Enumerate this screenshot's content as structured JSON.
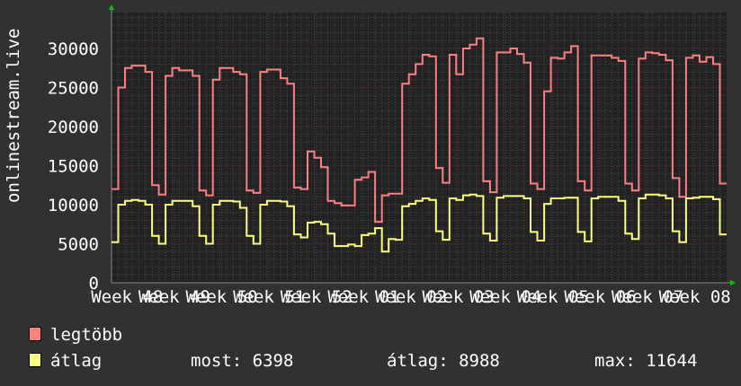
{
  "chart_data": {
    "type": "line",
    "ylabel": "onlinestream.live",
    "ylim": [
      0,
      30000
    ],
    "yticks": [
      "0",
      "5000",
      "10000",
      "15000",
      "20000",
      "25000",
      "30000"
    ],
    "xtick_labels": [
      "Week 48",
      "Week 49",
      "Week 50",
      "Week 51",
      "Week 52",
      "Week 01",
      "Week 02",
      "Week 03",
      "Week 04",
      "Week 05",
      "Week 06",
      "Week 07",
      "Week 08"
    ],
    "grid": true,
    "step": true,
    "series": [
      {
        "name": "legtöbb",
        "color": "#ff8080",
        "values": [
          12000,
          25000,
          27500,
          27800,
          27800,
          27000,
          12500,
          11300,
          26500,
          27500,
          27200,
          27200,
          26500,
          11800,
          11200,
          26000,
          27500,
          27500,
          27000,
          26700,
          11800,
          11500,
          27000,
          27300,
          27300,
          26200,
          25500,
          12200,
          12000,
          16800,
          16000,
          14800,
          10500,
          10200,
          9900,
          9900,
          13200,
          13500,
          14200,
          7800,
          11200,
          11400,
          11400,
          25500,
          26700,
          28000,
          29200,
          29000,
          14700,
          12800,
          29200,
          26700,
          30000,
          30500,
          31300,
          13000,
          11600,
          29500,
          29500,
          30000,
          29300,
          28200,
          12700,
          12000,
          24500,
          28800,
          28700,
          29500,
          30300,
          13000,
          11800,
          29100,
          29100,
          29100,
          28800,
          28400,
          12700,
          11800,
          28700,
          29500,
          29400,
          29200,
          28500,
          13400,
          11000,
          28800,
          29100,
          28300,
          28900,
          28000,
          12700
        ]
      },
      {
        "name": "átlag",
        "color": "#ffff80",
        "values": [
          5200,
          10000,
          10500,
          10600,
          10500,
          10000,
          6000,
          5000,
          10000,
          10500,
          10500,
          10500,
          9800,
          6000,
          5000,
          10000,
          10500,
          10500,
          10400,
          9600,
          6000,
          5000,
          10000,
          10500,
          10500,
          10400,
          9800,
          6200,
          5800,
          7700,
          7800,
          7500,
          6300,
          4700,
          4700,
          4900,
          4700,
          6100,
          6300,
          7000,
          4000,
          5600,
          5500,
          9800,
          10100,
          10500,
          10800,
          10600,
          6600,
          5500,
          10800,
          10600,
          11200,
          11300,
          11100,
          6300,
          5400,
          10900,
          11100,
          11100,
          11100,
          10800,
          6500,
          5400,
          10100,
          10800,
          10800,
          10900,
          10900,
          6500,
          5300,
          10800,
          11000,
          11000,
          11000,
          10500,
          6300,
          5600,
          10800,
          11300,
          11300,
          11200,
          10800,
          6600,
          5200,
          10800,
          10900,
          11000,
          11000,
          10700,
          6200
        ]
      }
    ]
  },
  "legend": {
    "max_label": "legtöbb",
    "avg_label": "átlag",
    "current": "most: 6398",
    "average": "átlag: 8988",
    "maximum": "max: 11644"
  },
  "colors": {
    "background": "#313131",
    "plot_background": "#222222",
    "axis_arrow": "#00cc00"
  }
}
